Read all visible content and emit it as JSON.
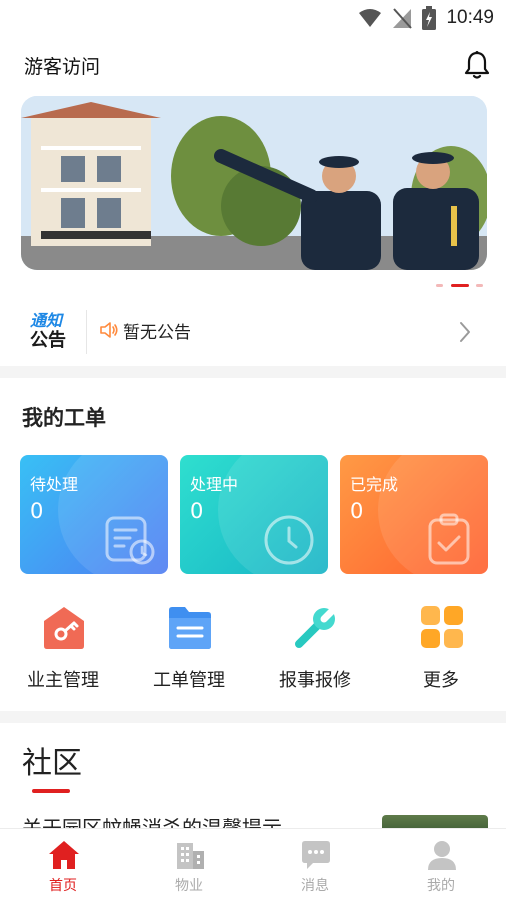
{
  "status_bar": {
    "time": "10:49"
  },
  "header": {
    "title": "游客访问"
  },
  "banner": {
    "slides": 3,
    "active_slide": 2
  },
  "notice": {
    "logo_line1": "通知",
    "logo_line2": "公告",
    "text": "暂无公告"
  },
  "work_orders": {
    "title": "我的工单",
    "cards": [
      {
        "label": "待处理",
        "count": "0"
      },
      {
        "label": "处理中",
        "count": "0"
      },
      {
        "label": "已完成",
        "count": "0"
      }
    ]
  },
  "quick_menu": [
    {
      "label": "业主管理"
    },
    {
      "label": "工单管理"
    },
    {
      "label": "报事报修"
    },
    {
      "label": "更多"
    }
  ],
  "community": {
    "title": "社区",
    "articles": [
      {
        "title": "关于园区蚊蝇消杀的温馨提示"
      }
    ]
  },
  "tabbar": {
    "active": 0,
    "items": [
      {
        "label": "首页"
      },
      {
        "label": "物业"
      },
      {
        "label": "消息"
      },
      {
        "label": "我的"
      }
    ]
  },
  "colors": {
    "accent": "#e02020",
    "pending": "#4f7cf2",
    "processing": "#17b3c6",
    "done": "#ff5f2e"
  }
}
